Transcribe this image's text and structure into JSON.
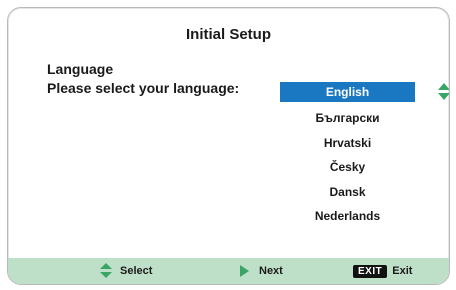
{
  "screen": {
    "title": "Initial Setup",
    "language_label": "Language",
    "prompt": "Please select your language:"
  },
  "languages": [
    {
      "label": "English",
      "selected": true
    },
    {
      "label": "Български",
      "selected": false
    },
    {
      "label": "Hrvatski",
      "selected": false
    },
    {
      "label": "Česky",
      "selected": false
    },
    {
      "label": "Dansk",
      "selected": false
    },
    {
      "label": "Nederlands",
      "selected": false
    }
  ],
  "footer": {
    "select_label": "Select",
    "next_label": "Next",
    "exit_key": "EXIT",
    "exit_label": "Exit"
  },
  "colors": {
    "selection": "#1a78c2",
    "footer_bg": "#bfe0c8",
    "icon_green": "#3aa564"
  },
  "icons": [
    "up-down-arrow-icon",
    "right-arrow-icon",
    "exit-key-icon"
  ]
}
